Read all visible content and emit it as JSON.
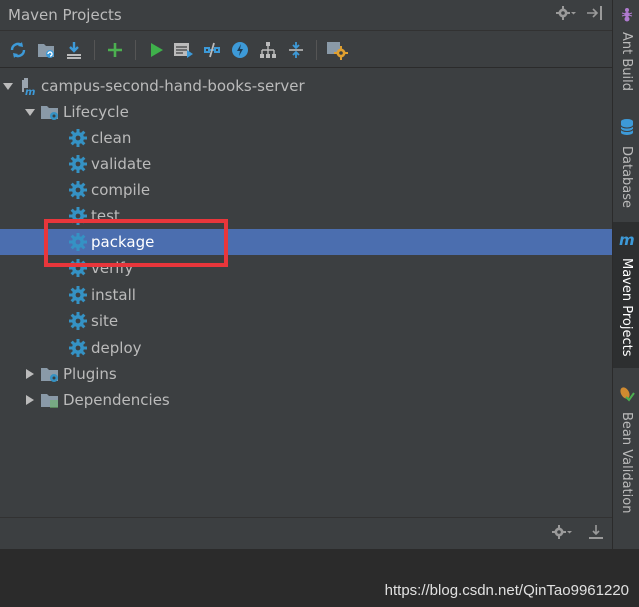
{
  "panel": {
    "title": "Maven Projects"
  },
  "toolbar": {
    "buttons": [
      {
        "name": "reimport-icon"
      },
      {
        "name": "generate-sources-icon"
      },
      {
        "name": "download-icon"
      },
      {
        "name": "add-icon"
      },
      {
        "name": "run-icon"
      },
      {
        "name": "execute-goal-icon"
      },
      {
        "name": "toggle-offline-icon"
      },
      {
        "name": "skip-tests-icon"
      },
      {
        "name": "show-dependencies-icon"
      },
      {
        "name": "collapse-all-icon"
      },
      {
        "name": "settings-icon"
      }
    ]
  },
  "tree": {
    "root": "campus-second-hand-books-server",
    "lifecycle": "Lifecycle",
    "goals": [
      "clean",
      "validate",
      "compile",
      "test",
      "package",
      "verify",
      "install",
      "site",
      "deploy"
    ],
    "selected": "package",
    "plugins": "Plugins",
    "dependencies": "Dependencies"
  },
  "right_tabs": [
    {
      "label": "Ant Build",
      "icon": "ant-icon"
    },
    {
      "label": "Database",
      "icon": "database-icon"
    },
    {
      "label": "Maven Projects",
      "icon": "maven-icon",
      "active": true
    },
    {
      "label": "Bean Validation",
      "icon": "bean-validation-icon"
    }
  ],
  "watermark": "https://blog.csdn.net/QinTao9961220",
  "colors": {
    "background": "#3c3f41",
    "selection": "#4b6eaf",
    "highlight": "#e8363b",
    "gear": "#3592c4"
  }
}
